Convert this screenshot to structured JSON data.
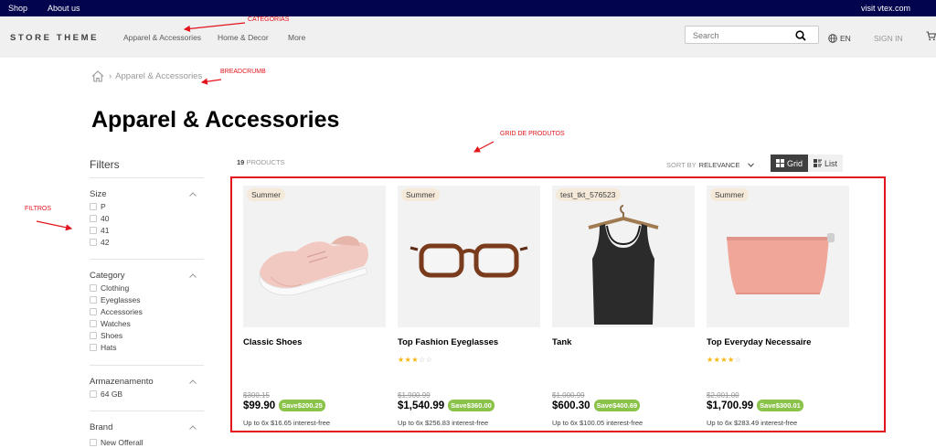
{
  "topbar": {
    "shop": "Shop",
    "about": "About us",
    "visit": "visit vtex.com"
  },
  "header": {
    "logo": "STORE THEME",
    "nav": [
      "Apparel & Accessories",
      "Home & Decor",
      "More"
    ],
    "search_placeholder": "Search",
    "lang": "EN",
    "signin": "SIGN IN"
  },
  "annotations": {
    "categorias": "CATEGORIAS",
    "breadcrumb": "BREADCRUMB",
    "grid": "GRID DE PRODUTOS",
    "filtros": "FILTROS"
  },
  "breadcrumb": {
    "sep": "›",
    "item": "Apparel & Accessories"
  },
  "page_title": "Apparel & Accessories",
  "filters": {
    "title": "Filters",
    "groups": [
      {
        "title": "Size",
        "items": [
          "P",
          "40",
          "41",
          "42"
        ]
      },
      {
        "title": "Category",
        "items": [
          "Clothing",
          "Eyeglasses",
          "Accessories",
          "Watches",
          "Shoes",
          "Hats"
        ]
      },
      {
        "title": "Armazenamento",
        "items": [
          "64 GB"
        ]
      },
      {
        "title": "Brand",
        "items": [
          "New Offerall"
        ]
      }
    ]
  },
  "results": {
    "count": "19",
    "count_label": "PRODUCTS"
  },
  "sort": {
    "label": "SORT BY",
    "value": "RELEVANCE"
  },
  "view": {
    "grid": "Grid",
    "list": "List"
  },
  "colors": {
    "topbar": "#03044e",
    "annotation": "#e3141c",
    "save_badge": "#8bc34a",
    "star": "#f7b50c"
  },
  "products": [
    {
      "badge": "Summer",
      "name": "Classic Shoes",
      "rating": 0,
      "list_price": "$300.15",
      "price": "$99.90",
      "save": "Save$200.25",
      "installments": "Up to 6x $16.65 interest-free"
    },
    {
      "badge": "Summer",
      "name": "Top Fashion Eyeglasses",
      "rating": 3,
      "list_price": "$1,900.99",
      "price": "$1,540.99",
      "save": "Save$360.00",
      "installments": "Up to 6x $256.83 interest-free"
    },
    {
      "badge": "test_tkt_576523",
      "name": "Tank",
      "rating": 0,
      "list_price": "$1,000.99",
      "price": "$600.30",
      "save": "Save$400.69",
      "installments": "Up to 6x $100.05 interest-free"
    },
    {
      "badge": "Summer",
      "name": "Top Everyday Necessaire",
      "rating": 4,
      "list_price": "$2,001.00",
      "price": "$1,700.99",
      "save": "Save$300.01",
      "installments": "Up to 6x $283.49 interest-free"
    }
  ]
}
